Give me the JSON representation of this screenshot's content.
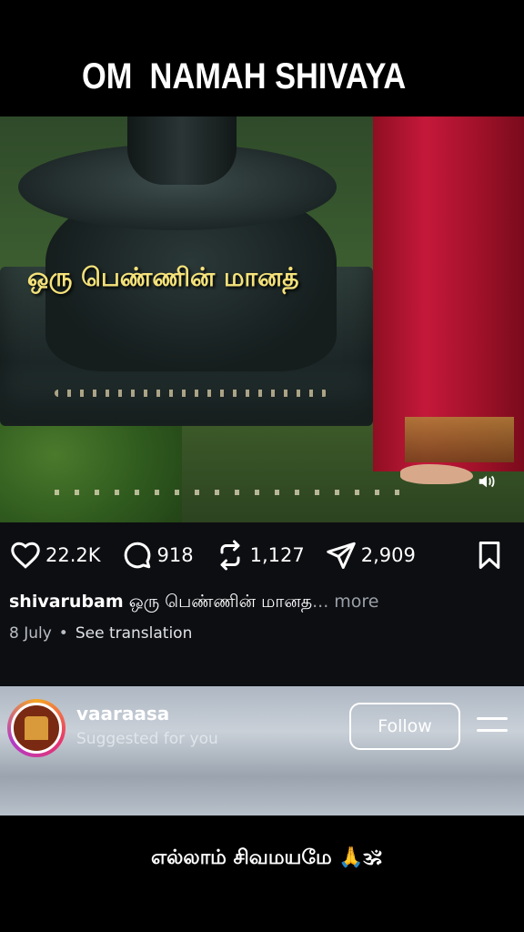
{
  "banner": {
    "title": "OM  NAMAH SHIVAYA"
  },
  "video": {
    "overlay_text": "ஒரு பெண்ணின் மானத்",
    "volume_icon": "volume-icon"
  },
  "actions": {
    "likes": "22.2K",
    "comments": "918",
    "reposts": "1,127",
    "shares": "2,909"
  },
  "post": {
    "username": "shivarubam",
    "caption": " ஒரு பெண்ணின் மானத",
    "more": "... more",
    "date": "8 July",
    "separator": "•",
    "translate": "See translation"
  },
  "suggested": {
    "username": "vaaraasa",
    "subtitle": "Suggested for you",
    "follow_label": "Follow"
  },
  "footer": {
    "caption": "எல்லாம் சிவமயமே 🙏🕉"
  }
}
